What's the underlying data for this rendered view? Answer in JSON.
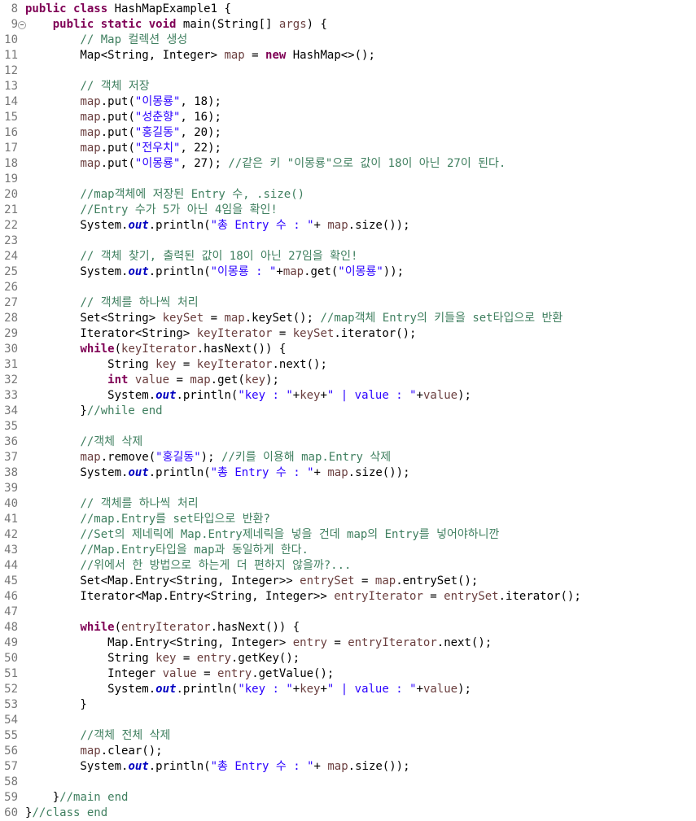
{
  "editor": {
    "lines": [
      {
        "n": "8",
        "t": [
          [
            "kw",
            "public"
          ],
          [
            "plain",
            " "
          ],
          [
            "kw",
            "class"
          ],
          [
            "plain",
            " HashMapExample1 {"
          ]
        ]
      },
      {
        "n": "9",
        "fold": true,
        "t": [
          [
            "plain",
            "    "
          ],
          [
            "kw",
            "public"
          ],
          [
            "plain",
            " "
          ],
          [
            "kw",
            "static"
          ],
          [
            "plain",
            " "
          ],
          [
            "kw",
            "void"
          ],
          [
            "plain",
            " main(String[] "
          ],
          [
            "var",
            "args"
          ],
          [
            "plain",
            ") {"
          ]
        ]
      },
      {
        "n": "10",
        "t": [
          [
            "plain",
            "        "
          ],
          [
            "com",
            "// Map 컬렉션 생성"
          ]
        ]
      },
      {
        "n": "11",
        "t": [
          [
            "plain",
            "        Map<String, Integer> "
          ],
          [
            "var",
            "map"
          ],
          [
            "plain",
            " = "
          ],
          [
            "kw",
            "new"
          ],
          [
            "plain",
            " HashMap<>();"
          ]
        ]
      },
      {
        "n": "12",
        "t": []
      },
      {
        "n": "13",
        "t": [
          [
            "plain",
            "        "
          ],
          [
            "com",
            "// 객체 저장"
          ]
        ]
      },
      {
        "n": "14",
        "t": [
          [
            "plain",
            "        "
          ],
          [
            "var",
            "map"
          ],
          [
            "plain",
            ".put("
          ],
          [
            "str",
            "\"이몽룡\""
          ],
          [
            "plain",
            ", 18);"
          ]
        ]
      },
      {
        "n": "15",
        "t": [
          [
            "plain",
            "        "
          ],
          [
            "var",
            "map"
          ],
          [
            "plain",
            ".put("
          ],
          [
            "str",
            "\"성춘향\""
          ],
          [
            "plain",
            ", 16);"
          ]
        ]
      },
      {
        "n": "16",
        "t": [
          [
            "plain",
            "        "
          ],
          [
            "var",
            "map"
          ],
          [
            "plain",
            ".put("
          ],
          [
            "str",
            "\"홍길동\""
          ],
          [
            "plain",
            ", 20);"
          ]
        ]
      },
      {
        "n": "17",
        "t": [
          [
            "plain",
            "        "
          ],
          [
            "var",
            "map"
          ],
          [
            "plain",
            ".put("
          ],
          [
            "str",
            "\"전우치\""
          ],
          [
            "plain",
            ", 22);"
          ]
        ]
      },
      {
        "n": "18",
        "t": [
          [
            "plain",
            "        "
          ],
          [
            "var",
            "map"
          ],
          [
            "plain",
            ".put("
          ],
          [
            "str",
            "\"이몽룡\""
          ],
          [
            "plain",
            ", 27); "
          ],
          [
            "com",
            "//같은 키 \"이몽룡\"으로 값이 18이 아닌 27이 된다."
          ]
        ]
      },
      {
        "n": "19",
        "t": []
      },
      {
        "n": "20",
        "t": [
          [
            "plain",
            "        "
          ],
          [
            "com",
            "//map객체에 저장된 Entry 수, .size()"
          ]
        ]
      },
      {
        "n": "21",
        "t": [
          [
            "plain",
            "        "
          ],
          [
            "com",
            "//Entry 수가 5가 아닌 4임을 확인!"
          ]
        ]
      },
      {
        "n": "22",
        "t": [
          [
            "plain",
            "        System."
          ],
          [
            "sf",
            "out"
          ],
          [
            "plain",
            ".println("
          ],
          [
            "str",
            "\"총 Entry 수 : \""
          ],
          [
            "plain",
            "+ "
          ],
          [
            "var",
            "map"
          ],
          [
            "plain",
            ".size());"
          ]
        ]
      },
      {
        "n": "23",
        "t": []
      },
      {
        "n": "24",
        "t": [
          [
            "plain",
            "        "
          ],
          [
            "com",
            "// 객체 찾기, 출력된 값이 18이 아닌 27임을 확인!"
          ]
        ]
      },
      {
        "n": "25",
        "t": [
          [
            "plain",
            "        System."
          ],
          [
            "sf",
            "out"
          ],
          [
            "plain",
            ".println("
          ],
          [
            "str",
            "\"이몽룡 : \""
          ],
          [
            "plain",
            "+"
          ],
          [
            "var",
            "map"
          ],
          [
            "plain",
            ".get("
          ],
          [
            "str",
            "\"이몽룡\""
          ],
          [
            "plain",
            "));"
          ]
        ]
      },
      {
        "n": "26",
        "t": []
      },
      {
        "n": "27",
        "t": [
          [
            "plain",
            "        "
          ],
          [
            "com",
            "// 객체를 하나씩 처리"
          ]
        ]
      },
      {
        "n": "28",
        "t": [
          [
            "plain",
            "        Set<String> "
          ],
          [
            "var",
            "keySet"
          ],
          [
            "plain",
            " = "
          ],
          [
            "var",
            "map"
          ],
          [
            "plain",
            ".keySet(); "
          ],
          [
            "com",
            "//map객체 Entry의 키들을 set타입으로 반환"
          ]
        ]
      },
      {
        "n": "29",
        "t": [
          [
            "plain",
            "        Iterator<String> "
          ],
          [
            "var",
            "keyIterator"
          ],
          [
            "plain",
            " = "
          ],
          [
            "var",
            "keySet"
          ],
          [
            "plain",
            ".iterator();"
          ]
        ]
      },
      {
        "n": "30",
        "t": [
          [
            "plain",
            "        "
          ],
          [
            "kw",
            "while"
          ],
          [
            "plain",
            "("
          ],
          [
            "var",
            "keyIterator"
          ],
          [
            "plain",
            ".hasNext()) {"
          ]
        ]
      },
      {
        "n": "31",
        "t": [
          [
            "plain",
            "            String "
          ],
          [
            "var",
            "key"
          ],
          [
            "plain",
            " = "
          ],
          [
            "var",
            "keyIterator"
          ],
          [
            "plain",
            ".next();"
          ]
        ]
      },
      {
        "n": "32",
        "t": [
          [
            "plain",
            "            "
          ],
          [
            "kw",
            "int"
          ],
          [
            "plain",
            " "
          ],
          [
            "var",
            "value"
          ],
          [
            "plain",
            " = "
          ],
          [
            "var",
            "map"
          ],
          [
            "plain",
            ".get("
          ],
          [
            "var",
            "key"
          ],
          [
            "plain",
            ");"
          ]
        ]
      },
      {
        "n": "33",
        "t": [
          [
            "plain",
            "            System."
          ],
          [
            "sf",
            "out"
          ],
          [
            "plain",
            ".println("
          ],
          [
            "str",
            "\"key : \""
          ],
          [
            "plain",
            "+"
          ],
          [
            "var",
            "key"
          ],
          [
            "plain",
            "+"
          ],
          [
            "str",
            "\" | value : \""
          ],
          [
            "plain",
            "+"
          ],
          [
            "var",
            "value"
          ],
          [
            "plain",
            ");"
          ]
        ]
      },
      {
        "n": "34",
        "t": [
          [
            "plain",
            "        }"
          ],
          [
            "com",
            "//while end"
          ]
        ]
      },
      {
        "n": "35",
        "t": []
      },
      {
        "n": "36",
        "t": [
          [
            "plain",
            "        "
          ],
          [
            "com",
            "//객체 삭제"
          ]
        ]
      },
      {
        "n": "37",
        "t": [
          [
            "plain",
            "        "
          ],
          [
            "var",
            "map"
          ],
          [
            "plain",
            ".remove("
          ],
          [
            "str",
            "\"홍길동\""
          ],
          [
            "plain",
            "); "
          ],
          [
            "com",
            "//키를 이용해 map.Entry 삭제"
          ]
        ]
      },
      {
        "n": "38",
        "t": [
          [
            "plain",
            "        System."
          ],
          [
            "sf",
            "out"
          ],
          [
            "plain",
            ".println("
          ],
          [
            "str",
            "\"총 Entry 수 : \""
          ],
          [
            "plain",
            "+ "
          ],
          [
            "var",
            "map"
          ],
          [
            "plain",
            ".size());"
          ]
        ]
      },
      {
        "n": "39",
        "t": []
      },
      {
        "n": "40",
        "t": [
          [
            "plain",
            "        "
          ],
          [
            "com",
            "// 객체를 하나씩 처리"
          ]
        ]
      },
      {
        "n": "41",
        "t": [
          [
            "plain",
            "        "
          ],
          [
            "com",
            "//map.Entry를 set타입으로 반환?"
          ]
        ]
      },
      {
        "n": "42",
        "t": [
          [
            "plain",
            "        "
          ],
          [
            "com",
            "//Set의 제네릭에 Map.Entry제네릭을 넣을 건데 map의 Entry를 넣어야하니깐"
          ]
        ]
      },
      {
        "n": "43",
        "t": [
          [
            "plain",
            "        "
          ],
          [
            "com",
            "//Map.Entry타입을 map과 동일하게 한다."
          ]
        ]
      },
      {
        "n": "44",
        "t": [
          [
            "plain",
            "        "
          ],
          [
            "com",
            "//위에서 한 방법으로 하는게 더 편하지 않을까?..."
          ]
        ]
      },
      {
        "n": "45",
        "t": [
          [
            "plain",
            "        Set<Map.Entry<String, Integer>> "
          ],
          [
            "var",
            "entrySet"
          ],
          [
            "plain",
            " = "
          ],
          [
            "var",
            "map"
          ],
          [
            "plain",
            ".entrySet();"
          ]
        ]
      },
      {
        "n": "46",
        "t": [
          [
            "plain",
            "        Iterator<Map.Entry<String, Integer>> "
          ],
          [
            "var",
            "entryIterator"
          ],
          [
            "plain",
            " = "
          ],
          [
            "var",
            "entrySet"
          ],
          [
            "plain",
            ".iterator();"
          ]
        ]
      },
      {
        "n": "47",
        "t": []
      },
      {
        "n": "48",
        "t": [
          [
            "plain",
            "        "
          ],
          [
            "kw",
            "while"
          ],
          [
            "plain",
            "("
          ],
          [
            "var",
            "entryIterator"
          ],
          [
            "plain",
            ".hasNext()) {"
          ]
        ]
      },
      {
        "n": "49",
        "t": [
          [
            "plain",
            "            Map.Entry<String, Integer> "
          ],
          [
            "var",
            "entry"
          ],
          [
            "plain",
            " = "
          ],
          [
            "var",
            "entryIterator"
          ],
          [
            "plain",
            ".next();"
          ]
        ]
      },
      {
        "n": "50",
        "t": [
          [
            "plain",
            "            String "
          ],
          [
            "var",
            "key"
          ],
          [
            "plain",
            " = "
          ],
          [
            "var",
            "entry"
          ],
          [
            "plain",
            ".getKey();"
          ]
        ]
      },
      {
        "n": "51",
        "t": [
          [
            "plain",
            "            Integer "
          ],
          [
            "var",
            "value"
          ],
          [
            "plain",
            " = "
          ],
          [
            "var",
            "entry"
          ],
          [
            "plain",
            ".getValue();"
          ]
        ]
      },
      {
        "n": "52",
        "t": [
          [
            "plain",
            "            System."
          ],
          [
            "sf",
            "out"
          ],
          [
            "plain",
            ".println("
          ],
          [
            "str",
            "\"key : \""
          ],
          [
            "plain",
            "+"
          ],
          [
            "var",
            "key"
          ],
          [
            "plain",
            "+"
          ],
          [
            "str",
            "\" | value : \""
          ],
          [
            "plain",
            "+"
          ],
          [
            "var",
            "value"
          ],
          [
            "plain",
            ");"
          ]
        ]
      },
      {
        "n": "53",
        "t": [
          [
            "plain",
            "        }"
          ]
        ]
      },
      {
        "n": "54",
        "t": []
      },
      {
        "n": "55",
        "t": [
          [
            "plain",
            "        "
          ],
          [
            "com",
            "//객체 전체 삭제"
          ]
        ]
      },
      {
        "n": "56",
        "t": [
          [
            "plain",
            "        "
          ],
          [
            "var",
            "map"
          ],
          [
            "plain",
            ".clear();"
          ]
        ]
      },
      {
        "n": "57",
        "t": [
          [
            "plain",
            "        System."
          ],
          [
            "sf",
            "out"
          ],
          [
            "plain",
            ".println("
          ],
          [
            "str",
            "\"총 Entry 수 : \""
          ],
          [
            "plain",
            "+ "
          ],
          [
            "var",
            "map"
          ],
          [
            "plain",
            ".size());"
          ]
        ]
      },
      {
        "n": "58",
        "t": []
      },
      {
        "n": "59",
        "t": [
          [
            "plain",
            "    }"
          ],
          [
            "com",
            "//main end"
          ]
        ]
      },
      {
        "n": "60",
        "t": [
          [
            "plain",
            "}"
          ],
          [
            "com",
            "//class end"
          ]
        ]
      }
    ]
  },
  "colors": {
    "keyword": "#7f0055",
    "string": "#2a00ff",
    "comment": "#3f7f5f",
    "static_field": "#0000c0",
    "local_variable": "#6a3e3e",
    "line_number": "#787878",
    "background": "#ffffff"
  }
}
